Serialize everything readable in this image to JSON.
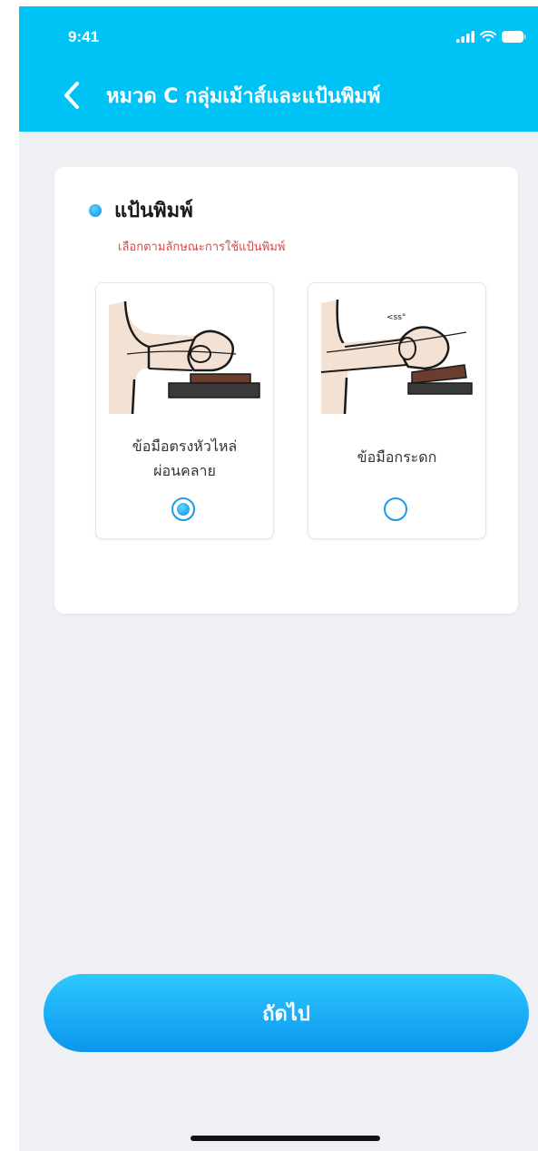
{
  "status_bar": {
    "time": "9:41",
    "icons": [
      "signal-icon",
      "wifi-icon",
      "battery-icon"
    ]
  },
  "header": {
    "back_icon": "chevron-left-icon",
    "title": "หมวด C กลุ่มเม้าส์และแป้นพิมพ์"
  },
  "section": {
    "title": "แป้นพิมพ์",
    "subtitle": "เลือกตามลักษณะการใช้แป้นพิมพ์"
  },
  "options": [
    {
      "label_line1": "ข้อมือตรงหัวไหล่",
      "label_line2": "ผ่อนคลาย",
      "selected": true,
      "illustration": "relaxed-wrist-illustration"
    },
    {
      "label_line1": "ข้อมือกระดก",
      "selected": false,
      "illustration": "bent-wrist-illustration",
      "illustration_text": "<ss°"
    }
  ],
  "next_button": {
    "label": "ถัดไป"
  },
  "colors": {
    "header": "#00c3f5",
    "accent": "#0b8ee6",
    "subtitle": "#d64a4a",
    "background": "#eef0f4"
  }
}
